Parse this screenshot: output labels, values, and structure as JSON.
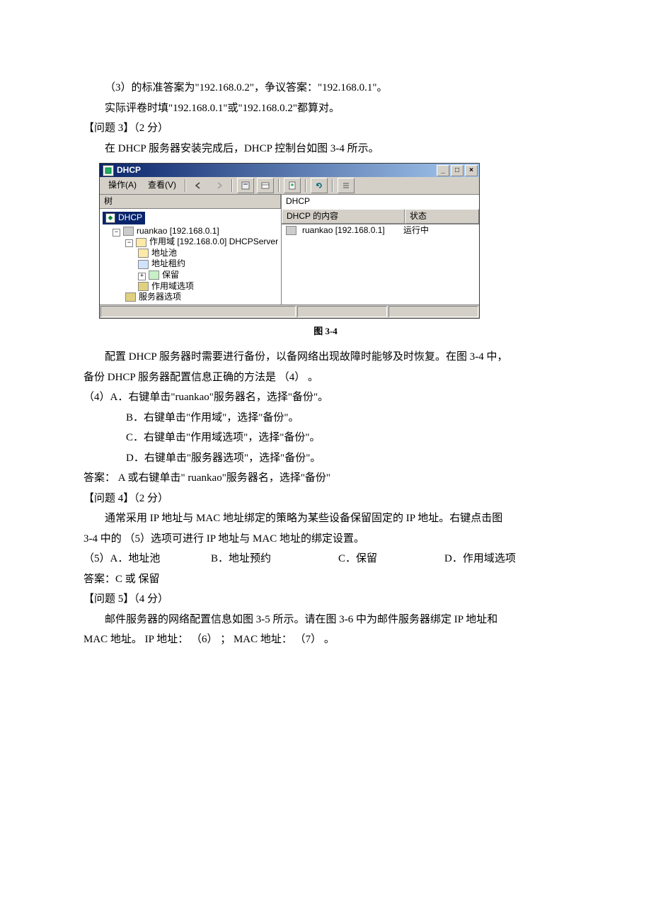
{
  "body": {
    "p1": "（3）的标准答案为\"192.168.0.2\"，争议答案：\"192.168.0.1\"。",
    "p2": "实际评卷时填\"192.168.0.1\"或\"192.168.0.2\"都算对。",
    "q3_label": "【问题 3】（2 分）",
    "q3_text": "在 DHCP 服务器安装完成后，DHCP 控制台如图 3-4 所示。",
    "fig_caption": "图 3-4",
    "after_fig_1": "配置 DHCP 服务器时需要进行备份，以备网络出现故障时能够及时恢复。在图 3-4 中，",
    "after_fig_2": "备份 DHCP 服务器配置信息正确的方法是 （4） 。",
    "opt4_a": "（4）A．右键单击\"ruankao\"服务器名，选择\"备份\"。",
    "opt4_b": "B．右键单击\"作用域\"，选择\"备份\"。",
    "opt4_c": "C．右键单击\"作用域选项\"，选择\"备份\"。",
    "opt4_d": "D．右键单击\"服务器选项\"，选择\"备份\"。",
    "ans4": "答案：   A  或右键单击\" ruankao\"服务器名，选择\"备份\"",
    "q4_label": "【问题 4】（2 分）",
    "q4_text1": "通常采用 IP 地址与 MAC 地址绑定的策略为某些设备保留固定的 IP 地址。右键点击图",
    "q4_text2": "3-4 中的 （5）选项可进行 IP 地址与 MAC 地址的绑定设置。",
    "opt5_a": "（5）A．地址池",
    "opt5_b": "B．地址预约",
    "opt5_c": "C．保留",
    "opt5_d": "D．作用域选项",
    "ans5": "答案：C 或 保留",
    "q5_label": "【问题 5】（4 分）",
    "q5_text1": "邮件服务器的网络配置信息如图 3-5 所示。请在图 3-6 中为邮件服务器绑定 IP 地址和",
    "q5_text2": "MAC 地址。   IP 地址：   （6） ；   MAC 地址： （7） 。"
  },
  "window": {
    "title": "DHCP",
    "menu_action": "操作(A)",
    "menu_view": "查看(V)",
    "tree_header": "树",
    "root": "DHCP",
    "server": "ruankao [192.168.0.1]",
    "scope": "作用域 [192.168.0.0] DHCPServer",
    "pool": "地址池",
    "lease": "地址租约",
    "reserve": "保留",
    "scope_opt": "作用域选项",
    "server_opt": "服务器选项",
    "list_title": "DHCP",
    "col_content": "DHCP 的内容",
    "col_status": "状态",
    "row_name": "ruankao [192.168.0.1]",
    "row_status": "运行中"
  }
}
